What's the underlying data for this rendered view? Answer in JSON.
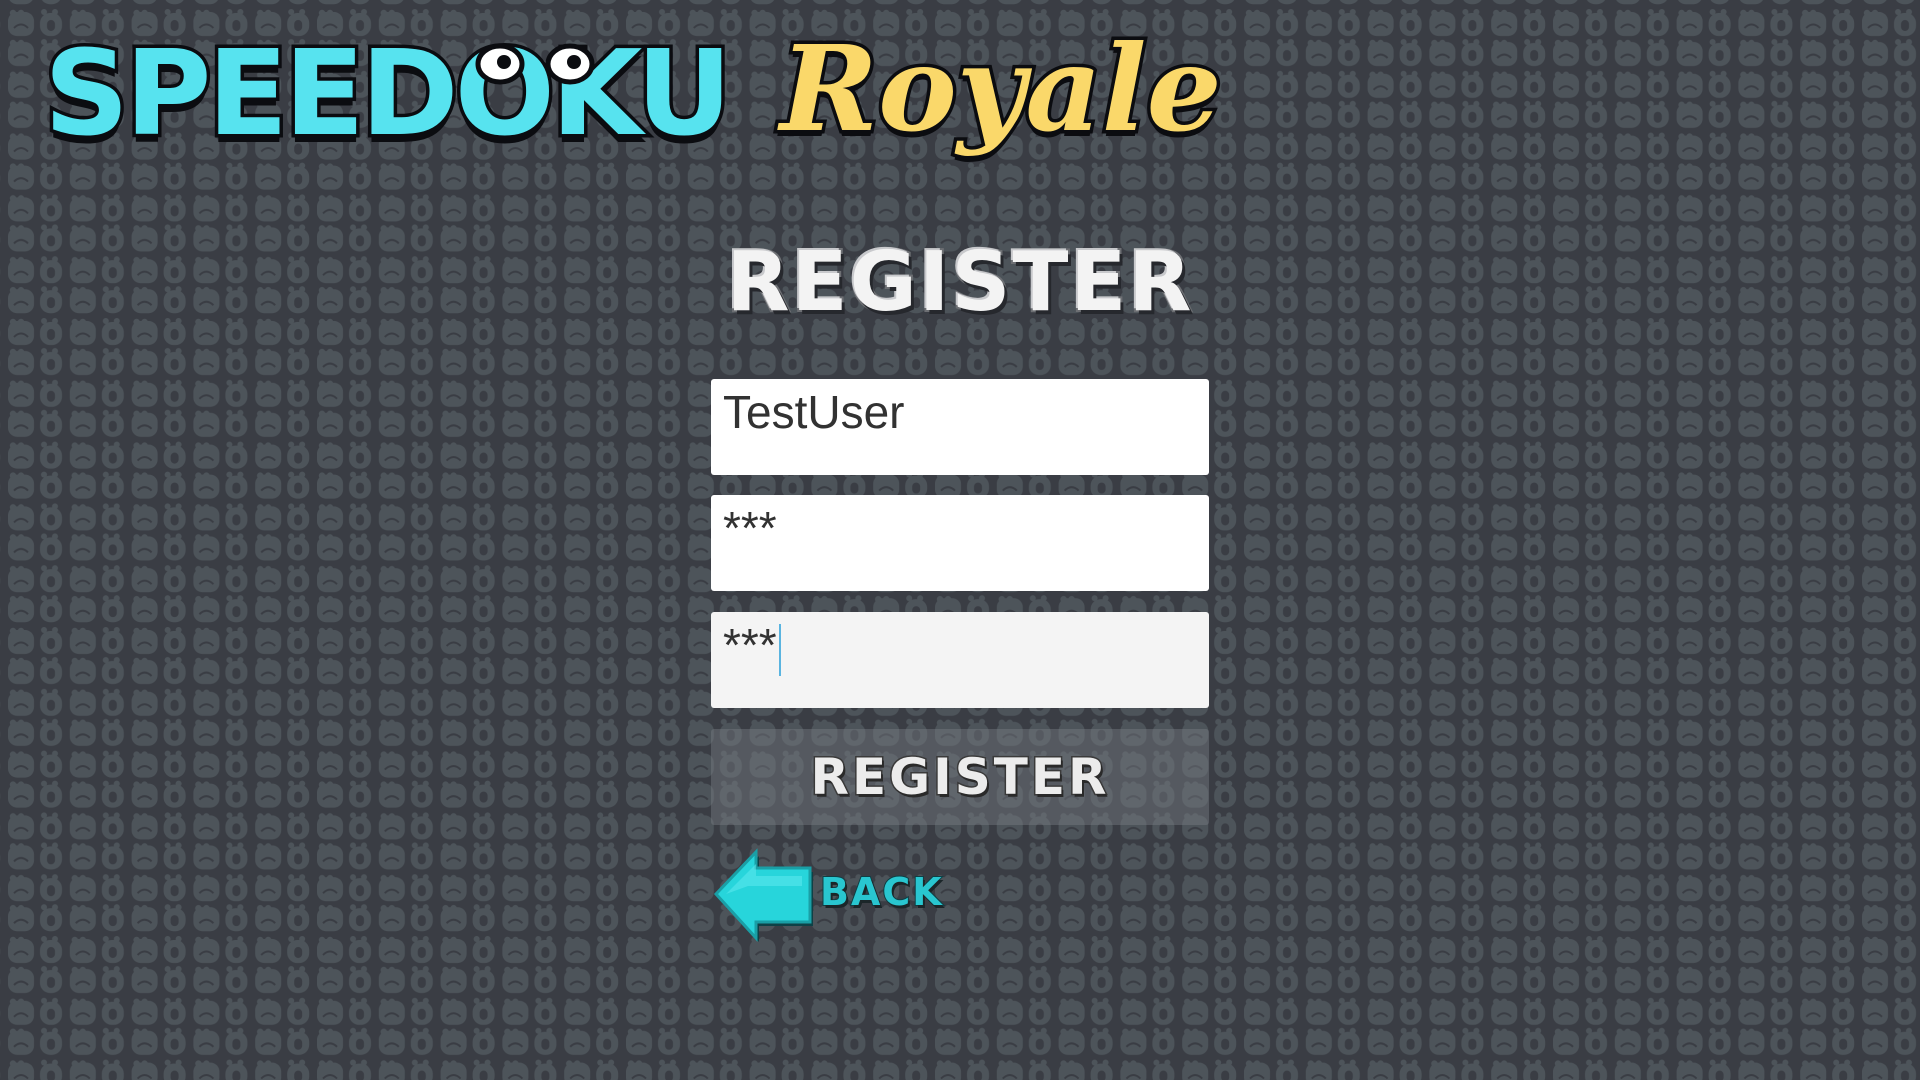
{
  "logo": {
    "word": "SPEEDOKU",
    "script": "Royale"
  },
  "heading": "REGISTER",
  "form": {
    "username_value": "TestUser",
    "password_value": "***",
    "confirm_password_value": "***",
    "register_label": "REGISTER",
    "back_label": "BACK"
  },
  "colors": {
    "background": "#3a3d44",
    "pattern": "#4d545a",
    "logo_cyan": "#57e3ef",
    "logo_yellow": "#fad86a",
    "back_cyan": "#29c6d0"
  }
}
